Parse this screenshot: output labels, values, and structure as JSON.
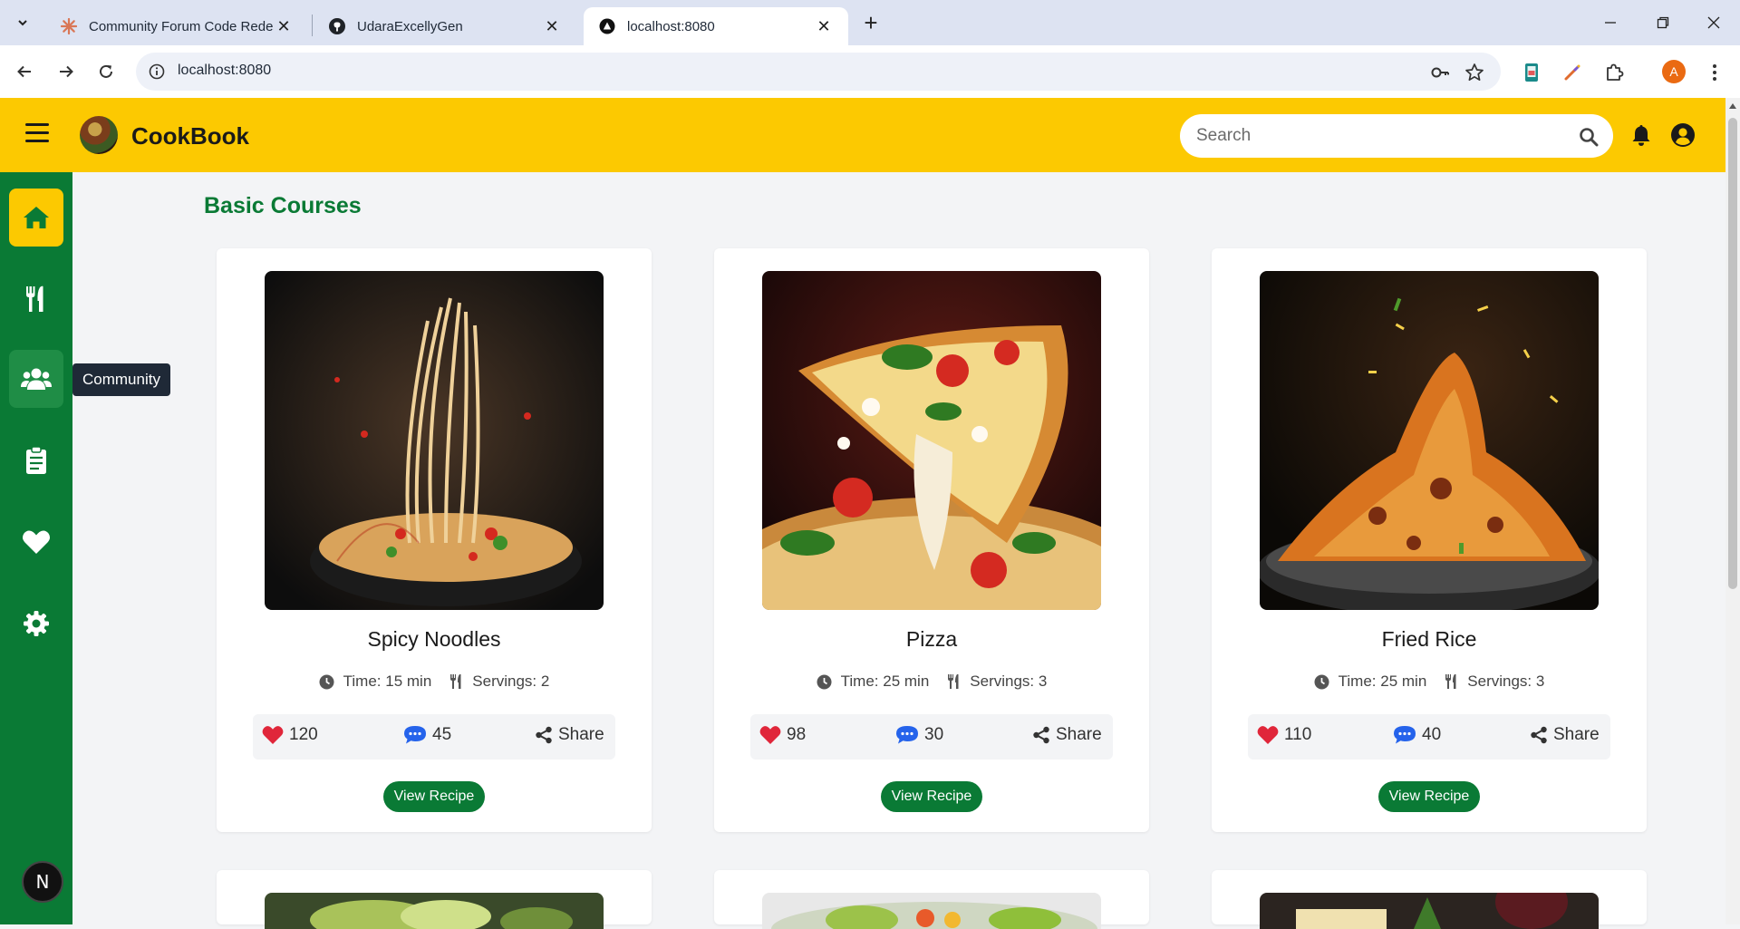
{
  "browser": {
    "tabs": [
      {
        "title": "Community Forum Code Redesi",
        "favicon": "claude-starburst-icon",
        "active": false
      },
      {
        "title": "UdaraExcellyGen",
        "favicon": "github-icon",
        "active": false
      },
      {
        "title": "localhost:8080",
        "favicon": "vercel-triangle-icon",
        "active": true
      }
    ],
    "url": "localhost:8080"
  },
  "header": {
    "brand": "CookBook",
    "search_placeholder": "Search",
    "accent_color": "#fcc901"
  },
  "sidebar": {
    "items": [
      {
        "icon": "home-icon",
        "label": "Home",
        "active": true
      },
      {
        "icon": "utensils-icon",
        "label": "Recipes",
        "active": false
      },
      {
        "icon": "users-icon",
        "label": "Community",
        "active": false
      },
      {
        "icon": "clipboard-icon",
        "label": "Planner",
        "active": false
      },
      {
        "icon": "heart-icon",
        "label": "Favorites",
        "active": false
      },
      {
        "icon": "gear-icon",
        "label": "Settings",
        "active": false
      }
    ],
    "tooltip": "Community",
    "color": "#0a7a35",
    "badge": "N"
  },
  "main": {
    "section_title": "Basic Courses",
    "recipes": [
      {
        "name": "Spicy Noodles",
        "time": "Time: 15 min",
        "servings": "Servings: 2",
        "likes": "120",
        "comments": "45",
        "share": "Share",
        "cta": "View Recipe"
      },
      {
        "name": "Pizza",
        "time": "Time: 25 min",
        "servings": "Servings: 3",
        "likes": "98",
        "comments": "30",
        "share": "Share",
        "cta": "View Recipe"
      },
      {
        "name": "Fried Rice",
        "time": "Time: 25 min",
        "servings": "Servings: 3",
        "likes": "110",
        "comments": "40",
        "share": "Share",
        "cta": "View Recipe"
      }
    ]
  }
}
